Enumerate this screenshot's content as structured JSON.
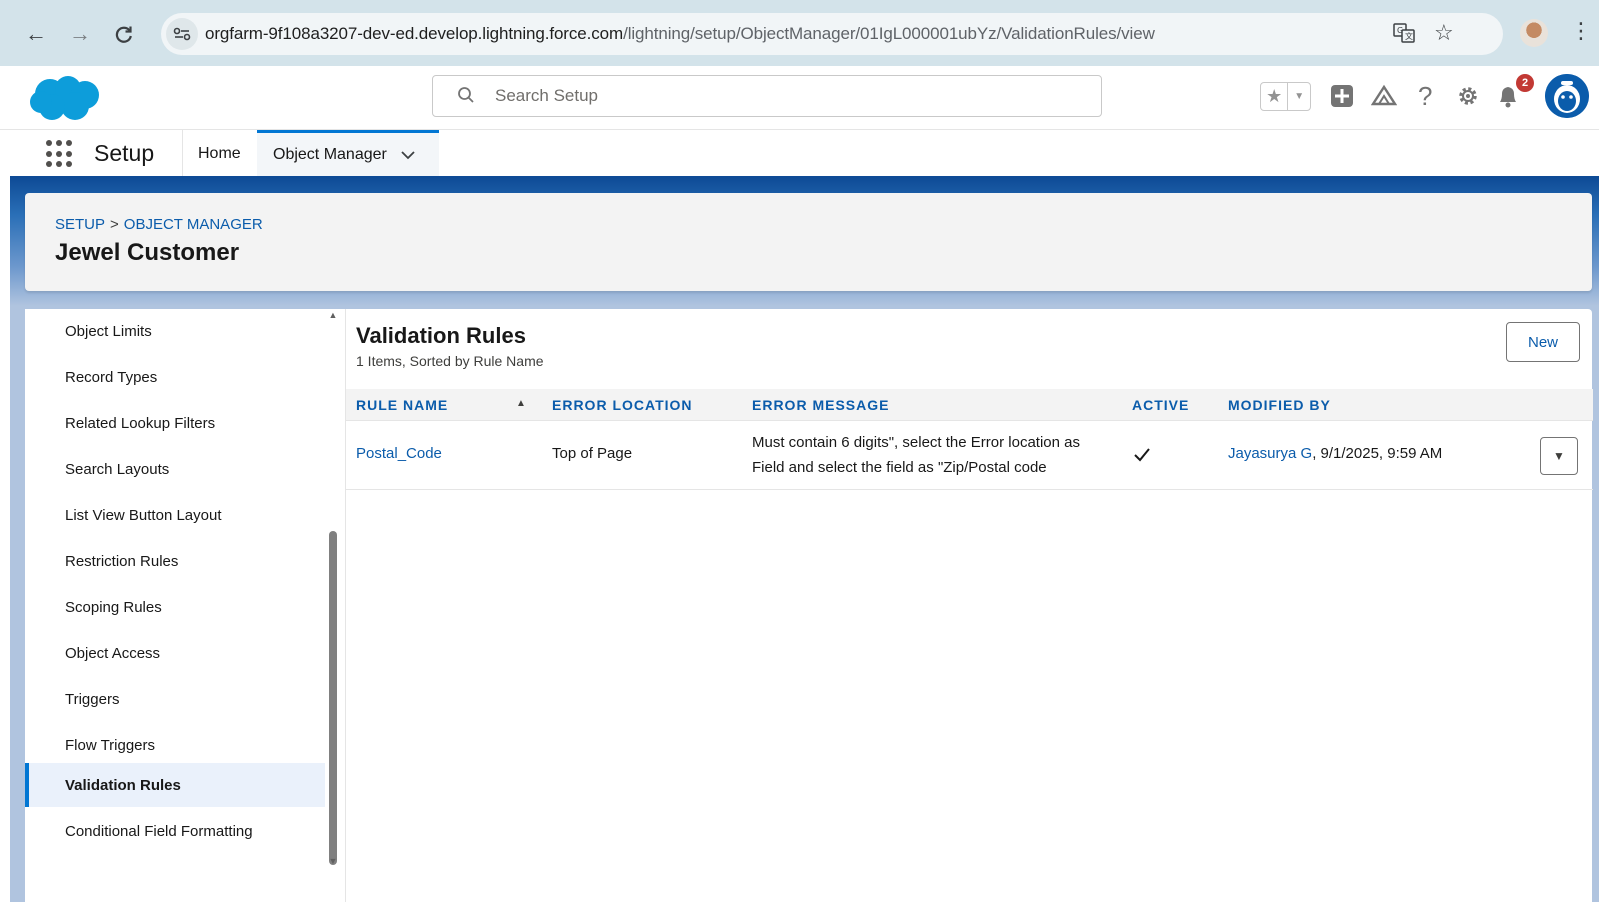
{
  "browser": {
    "url_domain": "orgfarm-9f108a3207-dev-ed.develop.lightning.force.com",
    "url_path": "/lightning/setup/ObjectManager/01IgL000001ubYz/ValidationRules/view",
    "icons": [
      "back-icon",
      "forward-icon",
      "reload-icon",
      "site-info-icon",
      "translate-icon",
      "bookmark-star-icon",
      "profile-avatar",
      "menu-kebab-icon"
    ]
  },
  "header": {
    "search_placeholder": "Search Setup",
    "notification_count": "2",
    "icons": [
      "salesforce-cloud-logo",
      "favorites-star-icon",
      "favorites-dropdown-icon",
      "global-create-icon",
      "trailhead-icon",
      "help-icon",
      "setup-gear-icon",
      "notification-bell-icon",
      "user-avatar"
    ]
  },
  "context_bar": {
    "app_name": "Setup",
    "tabs": [
      {
        "label": "Home"
      },
      {
        "label": "Object Manager",
        "active": true
      }
    ]
  },
  "page_header": {
    "breadcrumb": [
      "SETUP",
      "OBJECT MANAGER"
    ],
    "separator": ">",
    "title": "Jewel Customer"
  },
  "sidebar": {
    "items": [
      {
        "label": "Object Limits"
      },
      {
        "label": "Record Types"
      },
      {
        "label": "Related Lookup Filters"
      },
      {
        "label": "Search Layouts"
      },
      {
        "label": "List View Button Layout"
      },
      {
        "label": "Restriction Rules"
      },
      {
        "label": "Scoping Rules"
      },
      {
        "label": "Object Access"
      },
      {
        "label": "Triggers"
      },
      {
        "label": "Flow Triggers"
      },
      {
        "label": "Validation Rules",
        "selected": true
      },
      {
        "label": "Conditional Field Formatting"
      }
    ]
  },
  "list": {
    "title": "Validation Rules",
    "subtitle": "1 Items, Sorted by Rule Name",
    "new_label": "New",
    "columns": [
      "RULE NAME",
      "ERROR LOCATION",
      "ERROR MESSAGE",
      "ACTIVE",
      "MODIFIED BY"
    ],
    "rows": [
      {
        "rule_name": "Postal_Code",
        "error_location": "Top of Page",
        "error_message_line1": "Must contain 6 digits\", select the Error location as",
        "error_message_line2": "Field and select the field as \"Zip/Postal code",
        "active": true,
        "modified_by_user": "Jayasurya G",
        "modified_by_date": ", 9/1/2025, 9:59 AM"
      }
    ]
  },
  "colors": {
    "brand_blue": "#0176d3",
    "link_blue": "#0b5cab",
    "browser_bar": "#d3e3ea",
    "band_blue": "#b0c4df",
    "badge_red": "#c23934"
  }
}
